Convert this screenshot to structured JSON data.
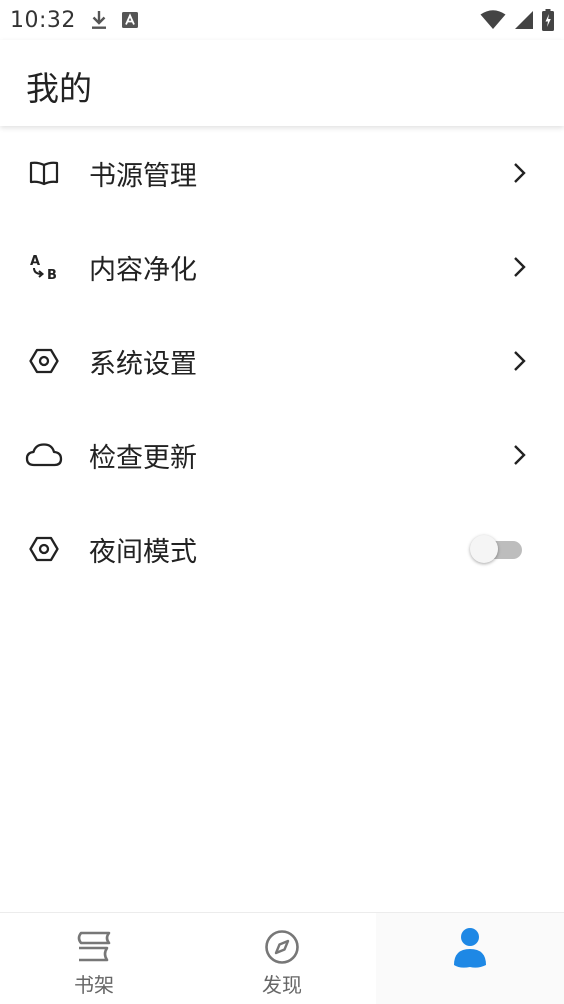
{
  "status_bar": {
    "time": "10:32",
    "icons": [
      "download-icon",
      "text-notification-icon",
      "wifi-icon",
      "signal-icon",
      "battery-charging-icon"
    ]
  },
  "app_bar": {
    "title": "我的"
  },
  "menu": {
    "items": [
      {
        "label": "书源管理",
        "icon": "book-open-icon",
        "trailing": "chevron"
      },
      {
        "label": "内容净化",
        "icon": "text-replace-icon",
        "trailing": "chevron"
      },
      {
        "label": "系统设置",
        "icon": "hexagon-settings-icon",
        "trailing": "chevron"
      },
      {
        "label": "检查更新",
        "icon": "cloud-icon",
        "trailing": "chevron"
      },
      {
        "label": "夜间模式",
        "icon": "hexagon-settings-icon",
        "trailing": "toggle",
        "toggle_on": false
      }
    ]
  },
  "bottom_nav": {
    "items": [
      {
        "label": "书架",
        "icon": "bookshelf-icon",
        "active": false
      },
      {
        "label": "发现",
        "icon": "compass-icon",
        "active": false
      },
      {
        "label": "",
        "icon": "person-icon",
        "active": true
      }
    ]
  },
  "colors": {
    "accent": "#1e88e5",
    "text_primary": "#222222",
    "text_secondary": "#666666",
    "toggle_track_off": "#bdbdbd"
  }
}
